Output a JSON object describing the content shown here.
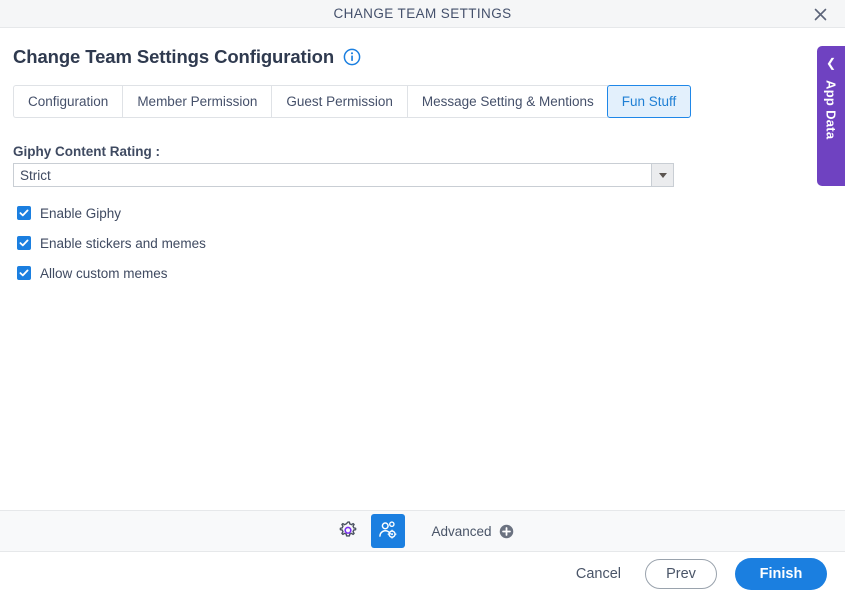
{
  "window": {
    "title": "CHANGE TEAM SETTINGS",
    "close_icon": "close-icon"
  },
  "page": {
    "heading": "Change Team Settings Configuration",
    "info_icon": "info-icon"
  },
  "tabs": [
    {
      "label": "Configuration",
      "active": false
    },
    {
      "label": "Member Permission",
      "active": false
    },
    {
      "label": "Guest Permission",
      "active": false
    },
    {
      "label": "Message Setting & Mentions",
      "active": false
    },
    {
      "label": "Fun Stuff",
      "active": true
    }
  ],
  "form": {
    "rating_label": "Giphy Content Rating :",
    "rating_value": "Strict",
    "dropdown_icon": "chevron-down-icon",
    "checkboxes": [
      {
        "label": "Enable Giphy",
        "checked": true
      },
      {
        "label": "Enable stickers and memes",
        "checked": true
      },
      {
        "label": "Allow custom memes",
        "checked": true
      }
    ]
  },
  "side_panel": {
    "label": "App Data",
    "collapse_icon": "chevron-left-icon"
  },
  "toolbar": {
    "gear_icon": "gear-icon",
    "user_settings_icon": "user-settings-icon",
    "advanced_label": "Advanced",
    "add_icon": "plus-circle-icon"
  },
  "footer": {
    "cancel_label": "Cancel",
    "prev_label": "Prev",
    "finish_label": "Finish"
  },
  "colors": {
    "accent_blue": "#1b7fe0",
    "active_tab_bg": "#e3f0fc",
    "purple": "#6f42c1",
    "toolbar_bg": "#f8f9fa"
  }
}
